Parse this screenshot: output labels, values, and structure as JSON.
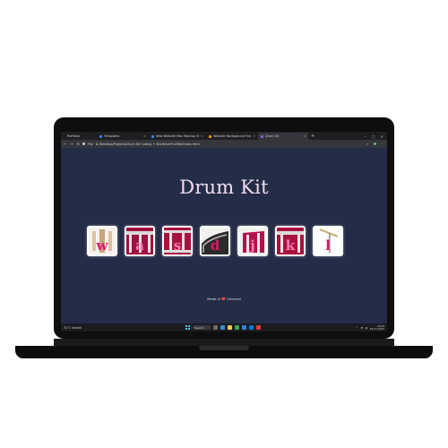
{
  "browser": {
    "tabs": [
      {
        "label": "Portfolio",
        "favicon_color": "#444444"
      },
      {
        "label": "Templates",
        "favicon_color": "#3b82f6"
      },
      {
        "label": "New Website Mac Mockup Vintage",
        "favicon_color": "#3b82f6"
      },
      {
        "label": "Website Background Font Image",
        "favicon_color": "#f59e0b"
      },
      {
        "label": "Drum Kit",
        "favicon_color": "#8b5cf6",
        "active": true
      }
    ],
    "new_tab": "+",
    "url_scheme": "File",
    "url": "D:/Desktop/Projects/Drum Kit Coding + Site/Drum%20Kit/index.html"
  },
  "page": {
    "title": "Drum Kit",
    "drums": [
      {
        "key": "w",
        "sound": "crash"
      },
      {
        "key": "a",
        "sound": "kick-bass"
      },
      {
        "key": "s",
        "sound": "snare"
      },
      {
        "key": "d",
        "sound": "tom-1"
      },
      {
        "key": "j",
        "sound": "tom-2"
      },
      {
        "key": "k",
        "sound": "tom-3"
      },
      {
        "key": "l",
        "sound": "tom-4"
      }
    ],
    "footer": "Made in ❤️ Chennai"
  },
  "taskbar": {
    "weather": "31°C Smoke",
    "search_placeholder": "Search",
    "time": "18:45",
    "date": "26-03-2025",
    "accent": "#4cc2ff"
  },
  "colors": {
    "page_bg": "#252c47",
    "title": "#f0dff0",
    "drum_letter": "#e0166b",
    "drum_accent": "#c2185b"
  }
}
